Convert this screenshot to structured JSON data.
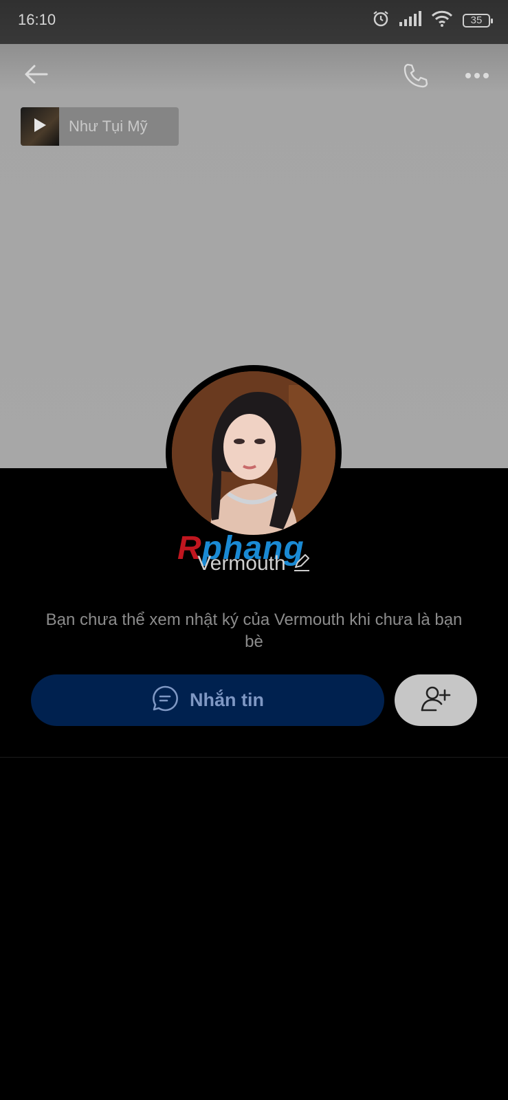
{
  "status_bar": {
    "time": "16:10",
    "battery": "35"
  },
  "music": {
    "title": "Như Tụi Mỹ"
  },
  "profile": {
    "name": "Vermouth",
    "watermark": "Rphang",
    "notice": "Bạn chưa thể xem nhật ký của Vermouth khi chưa là bạn bè"
  },
  "actions": {
    "message_label": "Nhắn tin"
  },
  "colors": {
    "cover": "#a7a7a7",
    "message_button": "#00214f",
    "message_text": "#7f98c4",
    "add_friend_button": "#c6c6c6"
  },
  "icons": [
    "alarm-icon",
    "signal-icon",
    "wifi-icon",
    "battery-icon",
    "back-arrow-icon",
    "phone-icon",
    "more-icon",
    "play-icon",
    "edit-icon",
    "chat-icon",
    "add-friend-icon"
  ]
}
